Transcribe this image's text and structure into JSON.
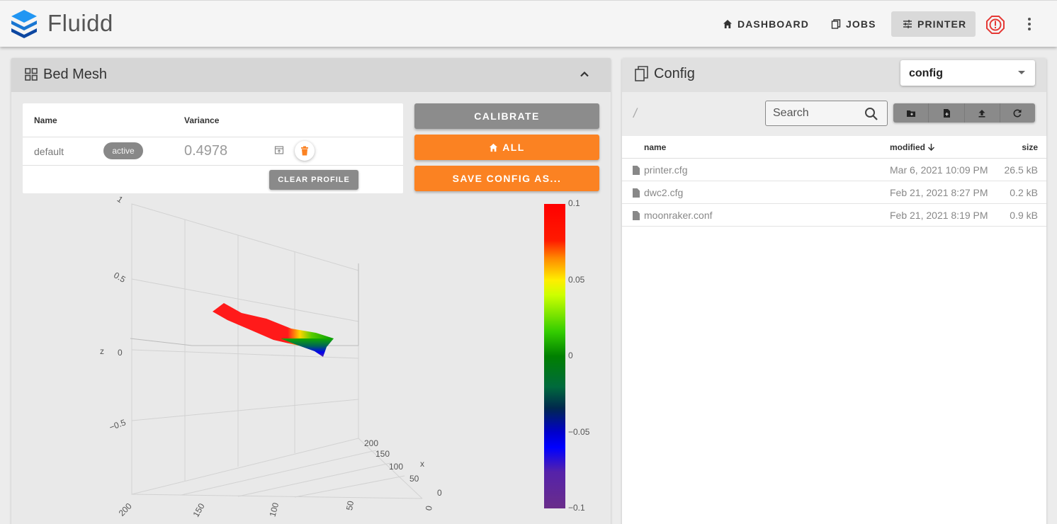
{
  "app": {
    "brand": "Fluidd"
  },
  "nav": {
    "dashboard": "DASHBOARD",
    "jobs": "JOBS",
    "printer": "PRINTER"
  },
  "bed_mesh": {
    "title": "Bed Mesh",
    "columns": {
      "name": "Name",
      "variance": "Variance"
    },
    "profile": {
      "name": "default",
      "status": "active",
      "variance": "0.4978"
    },
    "clear_profile": "CLEAR PROFILE",
    "calibrate": "CALIBRATE",
    "home_all": "ALL",
    "save_config": "SAVE CONFIG AS...",
    "plot": {
      "z_axis_label": "z",
      "x_axis_label": "x",
      "z_ticks": [
        "1",
        "0.5",
        "0",
        "−0.5"
      ],
      "x_ticks": [
        "200",
        "150",
        "100",
        "50",
        "0"
      ],
      "y_ticks": [
        "200",
        "150",
        "100",
        "50",
        "0"
      ]
    },
    "colorbar": {
      "ticks": [
        "0.1",
        "0.05",
        "0",
        "−0.05",
        "−0.1"
      ],
      "range": [
        -0.1,
        0.1
      ]
    }
  },
  "config": {
    "title": "Config",
    "selected_root": "config",
    "path": "/",
    "search_placeholder": "Search",
    "columns": {
      "name": "name",
      "modified": "modified",
      "size": "size"
    },
    "files": [
      {
        "name": "printer.cfg",
        "modified": "Mar 6, 2021 10:09 PM",
        "size": "26.5 kB"
      },
      {
        "name": "dwc2.cfg",
        "modified": "Feb 21, 2021 8:27 PM",
        "size": "0.2 kB"
      },
      {
        "name": "moonraker.conf",
        "modified": "Feb 21, 2021 8:19 PM",
        "size": "0.9 kB"
      }
    ]
  },
  "colors": {
    "brand_blue": "#1e88e5",
    "accent_orange": "#fb8222",
    "grey_button": "#8c8c8c",
    "estop_red": "#e53935"
  },
  "icons": {
    "logo": "fluidd-layers-logo",
    "dashboard": "home-icon",
    "jobs": "file-copy-icon",
    "printer": "tune-icon",
    "estop": "emergency-stop-icon",
    "menu": "kebab-menu-icon",
    "bed_mesh": "grid-icon",
    "config": "file-copy-icon",
    "search": "search-icon"
  }
}
